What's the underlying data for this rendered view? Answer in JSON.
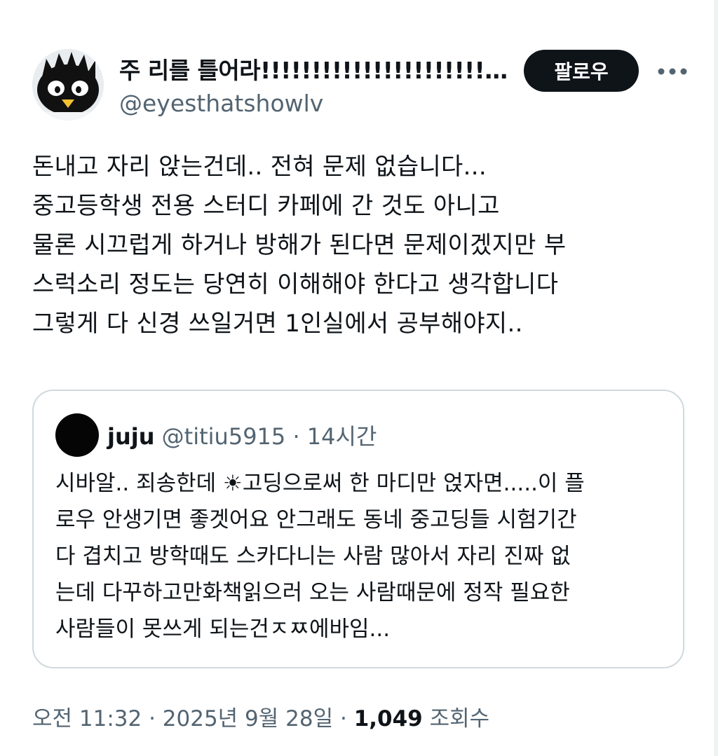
{
  "author": {
    "display_name": "주 리를 틀어라!!!!!!!!!!!!!!!!!!!!!!!!!!!!!...",
    "handle": "@eyesthatshowlv",
    "avatar_icon": "badtz-maru-avatar"
  },
  "actions": {
    "follow_label": "팔로우",
    "more_icon": "more-horizontal-icon"
  },
  "tweet": {
    "lines": [
      "돈내고 자리 앉는건데.. 전혀 문제 없습니다...",
      "중고등학생 전용 스터디 카페에 간 것도 아니고",
      "물론 시끄럽게 하거나 방해가 된다면 문제이겠지만 부",
      "스럭소리 정도는 당연히 이해해야 한다고 생각합니다",
      "그렇게 다 신경 쓰일거면 1인실에서 공부해야지.."
    ]
  },
  "quote": {
    "name": "juju",
    "handle": "@titiu5915",
    "separator": "·",
    "time": "14시간",
    "lines": [
      "시바알.. 죄송한데 ☀고딩으로써 한 마디만 얹자면.....이 플",
      "로우 안생기면 좋겟어요 안그래도 동네 중고딩들 시험기간",
      "다 겹치고 방학때도 스카다니는 사람 많아서 자리 진짜 없",
      "는데 다꾸하고만화책읽으러 오는 사람때문에 정작 필요한",
      "사람들이 못쓰게 되는건ㅈㅉ에바임..."
    ]
  },
  "meta": {
    "timestamp": "오전 11:32 · 2025년 9월 28일 · ",
    "views_count": "1,049",
    "views_label": " 조회수"
  },
  "colors": {
    "text": "#0f1419",
    "secondary": "#536471",
    "border": "#cfd9de",
    "follow_bg": "#0f1419"
  }
}
